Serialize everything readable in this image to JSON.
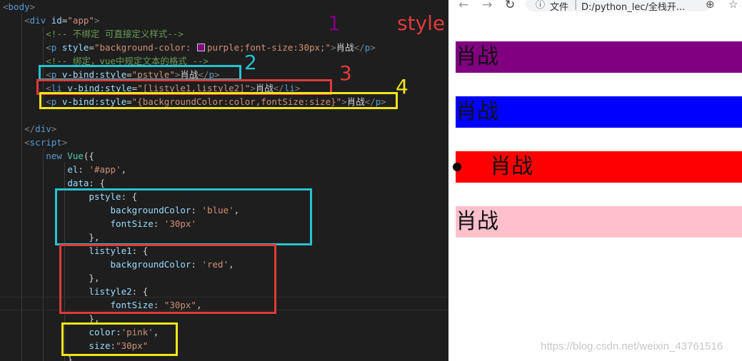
{
  "colors": {
    "annotation_1": "#800080",
    "annotation_2": "#27c2d0",
    "annotation_3": "#e03a3a",
    "annotation_4": "#f2e51b",
    "style_label": "#e03a3a"
  },
  "annotations": {
    "one": "1",
    "two": "2",
    "three": "3",
    "four": "4",
    "style_label": "style"
  },
  "editor": {
    "lines": [
      [
        {
          "t": "<",
          "c": "punc"
        },
        {
          "t": "body",
          "c": "tag"
        },
        {
          "t": ">",
          "c": "punc"
        }
      ],
      [
        {
          "t": "    "
        },
        {
          "t": "<",
          "c": "punc"
        },
        {
          "t": "div",
          "c": "tag"
        },
        {
          "t": " "
        },
        {
          "t": "id",
          "c": "attr"
        },
        {
          "t": "=",
          "c": "txt"
        },
        {
          "t": "\"app\"",
          "c": "str"
        },
        {
          "t": ">",
          "c": "punc"
        }
      ],
      [
        {
          "t": "        "
        },
        {
          "t": "<!-- 不绑定 可直接定义样式-->",
          "c": "com"
        }
      ],
      [
        {
          "t": "        "
        },
        {
          "t": "<",
          "c": "punc"
        },
        {
          "t": "p",
          "c": "tag"
        },
        {
          "t": " "
        },
        {
          "t": "style",
          "c": "attr"
        },
        {
          "t": "=",
          "c": "txt"
        },
        {
          "t": "\"background-color: ",
          "c": "str"
        },
        {
          "t": "",
          "c": "swatch"
        },
        {
          "t": "purple;font-size:30px;\"",
          "c": "str"
        },
        {
          "t": ">",
          "c": "punc"
        },
        {
          "t": "肖战",
          "c": "txt"
        },
        {
          "t": "</",
          "c": "punc"
        },
        {
          "t": "p",
          "c": "tag"
        },
        {
          "t": ">",
          "c": "punc"
        }
      ],
      [
        {
          "t": "        "
        },
        {
          "t": "<!-- 绑定，vue中规定文本的格式 -->",
          "c": "com"
        }
      ],
      [
        {
          "t": "        "
        },
        {
          "t": "<",
          "c": "punc"
        },
        {
          "t": "p",
          "c": "tag"
        },
        {
          "t": " "
        },
        {
          "t": "v-bind:style",
          "c": "attr"
        },
        {
          "t": "=",
          "c": "txt"
        },
        {
          "t": "\"pstyle\"",
          "c": "str"
        },
        {
          "t": ">",
          "c": "punc"
        },
        {
          "t": "肖战",
          "c": "txt"
        },
        {
          "t": "</",
          "c": "punc"
        },
        {
          "t": "p",
          "c": "tag"
        },
        {
          "t": ">",
          "c": "punc"
        }
      ],
      [
        {
          "t": "        "
        },
        {
          "t": "<",
          "c": "punc"
        },
        {
          "t": "li",
          "c": "tag"
        },
        {
          "t": " "
        },
        {
          "t": "v-bind:style",
          "c": "attr"
        },
        {
          "t": "=",
          "c": "txt"
        },
        {
          "t": "\"[listyle1,listyle2]\"",
          "c": "str"
        },
        {
          "t": ">",
          "c": "punc"
        },
        {
          "t": "肖战",
          "c": "txt"
        },
        {
          "t": "</",
          "c": "punc"
        },
        {
          "t": "li",
          "c": "tag"
        },
        {
          "t": ">",
          "c": "punc"
        }
      ],
      [
        {
          "t": "        "
        },
        {
          "t": "<",
          "c": "punc"
        },
        {
          "t": "p",
          "c": "tag"
        },
        {
          "t": " "
        },
        {
          "t": "v-bind:style",
          "c": "attr"
        },
        {
          "t": "=",
          "c": "txt"
        },
        {
          "t": "\"{backgroundColor:color,fontSize:size}\"",
          "c": "str"
        },
        {
          "t": ">",
          "c": "punc"
        },
        {
          "t": "肖战",
          "c": "txt"
        },
        {
          "t": "</",
          "c": "punc"
        },
        {
          "t": "p",
          "c": "tag"
        },
        {
          "t": ">",
          "c": "punc"
        }
      ],
      [],
      [
        {
          "t": "    "
        },
        {
          "t": "</",
          "c": "punc"
        },
        {
          "t": "div",
          "c": "tag"
        },
        {
          "t": ">",
          "c": "punc"
        }
      ],
      [
        {
          "t": "    "
        },
        {
          "t": "<",
          "c": "punc"
        },
        {
          "t": "script",
          "c": "tag"
        },
        {
          "t": ">",
          "c": "punc"
        }
      ],
      [
        {
          "t": "        "
        },
        {
          "t": "new",
          "c": "kw"
        },
        {
          "t": " "
        },
        {
          "t": "Vue",
          "c": "cls"
        },
        {
          "t": "({",
          "c": "txt"
        }
      ],
      [
        {
          "t": "            "
        },
        {
          "t": "el",
          "c": "prop"
        },
        {
          "t": ": ",
          "c": "txt"
        },
        {
          "t": "'#app'",
          "c": "str"
        },
        {
          "t": ",",
          "c": "txt"
        }
      ],
      [
        {
          "t": "            "
        },
        {
          "t": "data",
          "c": "prop"
        },
        {
          "t": ": {",
          "c": "txt"
        }
      ],
      [
        {
          "t": "                "
        },
        {
          "t": "pstyle",
          "c": "prop"
        },
        {
          "t": ": {",
          "c": "txt"
        }
      ],
      [
        {
          "t": "                    "
        },
        {
          "t": "backgroundColor",
          "c": "prop"
        },
        {
          "t": ": ",
          "c": "txt"
        },
        {
          "t": "'blue'",
          "c": "str"
        },
        {
          "t": ",",
          "c": "txt"
        }
      ],
      [
        {
          "t": "                    "
        },
        {
          "t": "fontSize",
          "c": "prop"
        },
        {
          "t": ": ",
          "c": "txt"
        },
        {
          "t": "'30px'",
          "c": "str"
        }
      ],
      [
        {
          "t": "                "
        },
        {
          "t": "},",
          "c": "txt"
        }
      ],
      [
        {
          "t": "                "
        },
        {
          "t": "listyle1",
          "c": "prop"
        },
        {
          "t": ": {",
          "c": "txt"
        }
      ],
      [
        {
          "t": "                    "
        },
        {
          "t": "backgroundColor",
          "c": "prop"
        },
        {
          "t": ": ",
          "c": "txt"
        },
        {
          "t": "'red'",
          "c": "str"
        },
        {
          "t": ",",
          "c": "txt"
        }
      ],
      [
        {
          "t": "                "
        },
        {
          "t": "},",
          "c": "txt"
        }
      ],
      [
        {
          "t": "                "
        },
        {
          "t": "listyle2",
          "c": "prop"
        },
        {
          "t": ": {",
          "c": "txt"
        }
      ],
      [
        {
          "t": "                    "
        },
        {
          "t": "fontSize",
          "c": "prop"
        },
        {
          "t": ": ",
          "c": "txt"
        },
        {
          "t": "\"30px\"",
          "c": "str"
        },
        {
          "t": ",",
          "c": "txt"
        }
      ],
      [
        {
          "t": "                "
        },
        {
          "t": "},",
          "c": "txt"
        }
      ],
      [
        {
          "t": "                "
        },
        {
          "t": "color",
          "c": "prop"
        },
        {
          "t": ":",
          "c": "txt"
        },
        {
          "t": "'pink'",
          "c": "str"
        },
        {
          "t": ",",
          "c": "txt"
        }
      ],
      [
        {
          "t": "                "
        },
        {
          "t": "size",
          "c": "prop"
        },
        {
          "t": ":",
          "c": "txt"
        },
        {
          "t": "\"30px\"",
          "c": "str"
        }
      ],
      [
        {
          "t": "            "
        },
        {
          "t": "}",
          "c": "txt"
        }
      ]
    ]
  },
  "browser": {
    "address_label": "文件",
    "address_separator": "|",
    "url": "D:/python_lec/全栈开...",
    "icons": {
      "back": "back-arrow-icon",
      "forward": "forward-arrow-icon",
      "reload": "reload-icon",
      "info": "info-icon",
      "zoom": "zoom-icon",
      "bookmark": "star-icon"
    },
    "outputs": [
      {
        "text": "肖战",
        "bg": "#800080"
      },
      {
        "text": "肖战",
        "bg": "#0000ff"
      },
      {
        "text": "肖战",
        "bg": "#ff0000"
      },
      {
        "text": "肖战",
        "bg": "#ffc0cb"
      }
    ]
  },
  "watermark": "https://blog.csdn.net/weixin_43761516"
}
